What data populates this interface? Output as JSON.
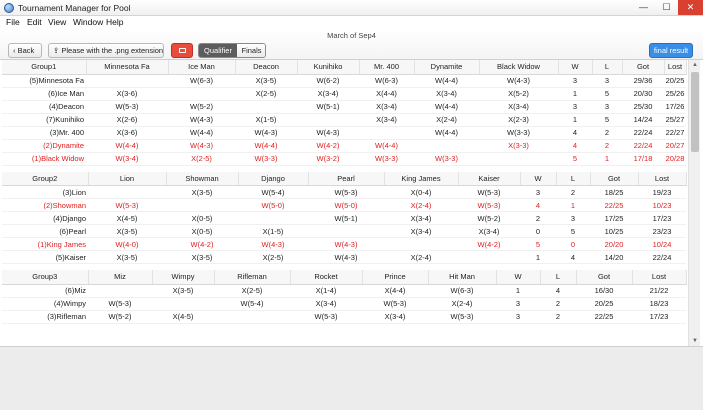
{
  "window": {
    "title": "Tournament Manager for Pool",
    "min": "—",
    "max": "☐",
    "close": "✕"
  },
  "menu": [
    "File",
    "Edit",
    "View",
    "Window",
    "Help"
  ],
  "toolbar": {
    "subtitle": "March of Sep4",
    "back": "‹ Back",
    "png": "⇪ Please with the .png extension",
    "seg_qualifier": "Qualifier",
    "seg_finals": "Finals",
    "final_result": "final result"
  },
  "groups": [
    {
      "headers": [
        "Group1",
        "Minnesota Fa",
        "Ice Man",
        "Deacon",
        "Kunihiko",
        "Mr. 400",
        "Dynamite",
        "Black Widow",
        "W",
        "L",
        "Got",
        "Lost"
      ],
      "rows": [
        {
          "red": false,
          "cells": [
            "(5)Minnesota Fa",
            "",
            "W(6-3)",
            "X(3-5)",
            "W(6-2)",
            "W(6-3)",
            "W(4-4)",
            "W(4-3)",
            "3",
            "3",
            "29/36",
            "20/25"
          ]
        },
        {
          "red": false,
          "cells": [
            "(6)Ice Man",
            "X(3-6)",
            "",
            "X(2-5)",
            "X(3-4)",
            "X(4-4)",
            "X(3-4)",
            "X(5-2)",
            "1",
            "5",
            "20/30",
            "25/26"
          ]
        },
        {
          "red": false,
          "cells": [
            "(4)Deacon",
            "W(5-3)",
            "W(5-2)",
            "",
            "W(5-1)",
            "X(3-4)",
            "W(4-4)",
            "X(3-4)",
            "3",
            "3",
            "25/30",
            "17/26"
          ]
        },
        {
          "red": false,
          "cells": [
            "(7)Kunihiko",
            "X(2-6)",
            "W(4-3)",
            "X(1-5)",
            "",
            "X(3-4)",
            "X(2-4)",
            "X(2-3)",
            "1",
            "5",
            "14/24",
            "25/27"
          ]
        },
        {
          "red": false,
          "cells": [
            "(3)Mr. 400",
            "X(3-6)",
            "W(4-4)",
            "W(4-3)",
            "W(4-3)",
            "",
            "W(4-4)",
            "W(3-3)",
            "4",
            "2",
            "22/24",
            "22/27"
          ]
        },
        {
          "red": true,
          "cells": [
            "(2)Dynamite",
            "W(4-4)",
            "W(4-3)",
            "W(4-4)",
            "W(4-2)",
            "W(4-4)",
            "",
            "X(3-3)",
            "4",
            "2",
            "22/24",
            "20/27"
          ]
        },
        {
          "red": true,
          "cells": [
            "(1)Black Widow",
            "W(3-4)",
            "X(2-5)",
            "W(3-3)",
            "W(3-2)",
            "W(3-3)",
            "W(3-3)",
            "",
            "5",
            "1",
            "17/18",
            "20/28"
          ]
        }
      ]
    },
    {
      "headers": [
        "Group2",
        "Lion",
        "Showman",
        "Django",
        "Pearl",
        "King James",
        "Kaiser",
        "W",
        "L",
        "Got",
        "Lost"
      ],
      "rows": [
        {
          "red": false,
          "cells": [
            "(3)Lion",
            "",
            "X(3-5)",
            "W(5-4)",
            "W(5-3)",
            "X(0-4)",
            "W(5-3)",
            "3",
            "2",
            "18/25",
            "19/23"
          ]
        },
        {
          "red": true,
          "cells": [
            "(2)Showman",
            "W(5-3)",
            "",
            "W(5-0)",
            "W(5-0)",
            "X(2-4)",
            "W(5-3)",
            "4",
            "1",
            "22/25",
            "10/23"
          ]
        },
        {
          "red": false,
          "cells": [
            "(4)Django",
            "X(4-5)",
            "X(0-5)",
            "",
            "W(5-1)",
            "X(3-4)",
            "W(5-2)",
            "2",
            "3",
            "17/25",
            "17/23"
          ]
        },
        {
          "red": false,
          "cells": [
            "(6)Pearl",
            "X(3-5)",
            "X(0-5)",
            "X(1-5)",
            "",
            "X(3-4)",
            "X(3-4)",
            "0",
            "5",
            "10/25",
            "23/23"
          ]
        },
        {
          "red": true,
          "cells": [
            "(1)King James",
            "W(4-0)",
            "W(4-2)",
            "W(4-3)",
            "W(4-3)",
            "",
            "W(4-2)",
            "5",
            "0",
            "20/20",
            "10/24"
          ]
        },
        {
          "red": false,
          "cells": [
            "(5)Kaiser",
            "X(3-5)",
            "X(3-5)",
            "X(2-5)",
            "W(4-3)",
            "X(2-4)",
            "",
            "1",
            "4",
            "14/20",
            "22/24"
          ]
        }
      ]
    },
    {
      "headers": [
        "Group3",
        "Miz",
        "Wimpy",
        "Rifleman",
        "Rocket",
        "Prince",
        "Hit Man",
        "W",
        "L",
        "Got",
        "Lost"
      ],
      "rows": [
        {
          "red": false,
          "cells": [
            "(6)Miz",
            "",
            "X(3-5)",
            "X(2-5)",
            "X(1-4)",
            "X(4-4)",
            "W(6-3)",
            "1",
            "4",
            "16/30",
            "21/22"
          ]
        },
        {
          "red": false,
          "cells": [
            "(4)Wimpy",
            "W(5-3)",
            "",
            "W(5-4)",
            "X(3-4)",
            "W(5-3)",
            "X(2-4)",
            "3",
            "2",
            "20/25",
            "18/23"
          ]
        },
        {
          "red": false,
          "cells": [
            "(3)Rifleman",
            "W(5-2)",
            "X(4-5)",
            "",
            "W(5-3)",
            "X(3-4)",
            "W(5-3)",
            "3",
            "2",
            "22/25",
            "17/23"
          ]
        }
      ]
    }
  ],
  "scrollbar": {
    "up": "▲",
    "down": "▼"
  }
}
